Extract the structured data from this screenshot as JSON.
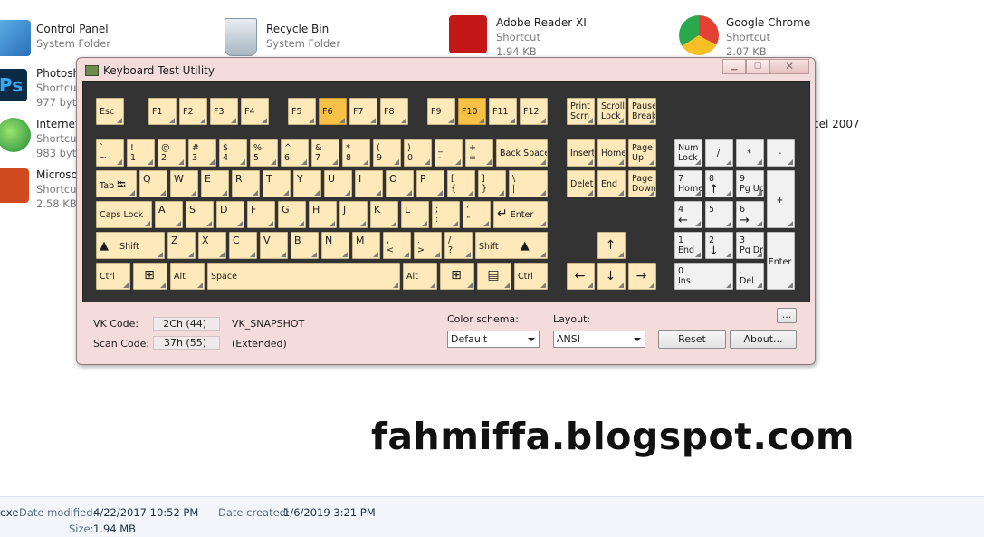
{
  "desktop": {
    "icons": [
      {
        "name": "Control Panel",
        "sub": "System Folder"
      },
      {
        "name": "Recycle Bin",
        "sub": "System Folder"
      },
      {
        "name": "Adobe Reader XI",
        "sub": "Shortcut",
        "size": "1.94 KB"
      },
      {
        "name": "Google Chrome",
        "sub": "Shortcut",
        "size": "2.07 KB"
      },
      {
        "name": "Photosh",
        "sub": "Shortcu",
        "size": "977 byte"
      },
      {
        "name": "Internet",
        "sub": "Shortcu",
        "size": "983 byte"
      },
      {
        "name": "Microso",
        "sub": "Shortcu",
        "size": "2.58 KB"
      },
      {
        "name": "cel 2007"
      }
    ],
    "watermark": "fahmiffa.blogspot.com"
  },
  "statusbar": {
    "prefix": "exe",
    "date_modified_label": "Date modified:",
    "date_modified": "4/22/2017 10:52 PM",
    "date_created_label": "Date created:",
    "date_created": "1/6/2019 3:21 PM",
    "size_label": "Size:",
    "size": "1.94 MB"
  },
  "window": {
    "title": "Keyboard Test Utility",
    "minimize": "▁",
    "maximize": "▢",
    "close": "✕"
  },
  "keys": {
    "esc": "Esc",
    "f1": "F1",
    "f2": "F2",
    "f3": "F3",
    "f4": "F4",
    "f5": "F5",
    "f6": "F6",
    "f7": "F7",
    "f8": "F8",
    "f9": "F9",
    "f10": "F10",
    "f11": "F11",
    "f12": "F12",
    "prtsc1": "Print",
    "prtsc2": "Scrn",
    "scroll1": "Scroll",
    "scroll2": "Lock",
    "pause1": "Pause",
    "pause2": "Break",
    "backtick1": "`",
    "backtick2": "~",
    "n1a": "!",
    "n1b": "1",
    "n2a": "@",
    "n2b": "2",
    "n3a": "#",
    "n3b": "3",
    "n4a": "$",
    "n4b": "4",
    "n5a": "%",
    "n5b": "5",
    "n6a": "^",
    "n6b": "6",
    "n7a": "&",
    "n7b": "7",
    "n8a": "*",
    "n8b": "8",
    "n9a": "(",
    "n9b": "9",
    "n0a": ")",
    "n0b": "0",
    "minusa": "_",
    "minusb": "-",
    "equala": "+",
    "equalb": "=",
    "backspace": "Back Space",
    "insert": "Insert",
    "home": "Home",
    "pgup1": "Page",
    "pgup2": "Up",
    "numlock1": "Num",
    "numlock2": "Lock",
    "numdiv": "/",
    "nummul": "*",
    "numsub": "-",
    "tab": "Tab",
    "tabglyph": "⭾",
    "q": "Q",
    "w": "W",
    "e": "E",
    "r": "R",
    "t": "T",
    "y": "Y",
    "u": "U",
    "i": "I",
    "o": "O",
    "p": "P",
    "lbra": "[",
    "lbrb": "{",
    "rbra": "]",
    "rbrb": "}",
    "bsla": "\\",
    "bslb": "|",
    "delete": "Delete",
    "end": "End",
    "pgdn1": "Page",
    "pgdn2": "Down",
    "num7a": "7",
    "num7b": "Home",
    "num8a": "8",
    "num8b": "↑",
    "num9a": "9",
    "num9b": "Pg Up",
    "numadd": "+",
    "caps": "Caps Lock",
    "a": "A",
    "s": "S",
    "d": "D",
    "f": "F",
    "g": "G",
    "h": "H",
    "j": "J",
    "k": "K",
    "l": "L",
    "semia": ";",
    "semib": ":",
    "quota": "'",
    "quotb": "\"",
    "enterglyph": "↵",
    "enter": "Enter",
    "num4a": "4",
    "num4b": "←",
    "num5a": "5",
    "num6a": "6",
    "num6b": "→",
    "shiftglyph": "▲",
    "shift": "Shift",
    "z": "Z",
    "x": "X",
    "c": "C",
    "v": "V",
    "b": "B",
    "n": "N",
    "m": "M",
    "comma1": ",",
    "comma2": "<",
    "period1": ".",
    "period2": ">",
    "slash1": "/",
    "slash2": "?",
    "up": "↑",
    "num1a": "1",
    "num1b": "End",
    "num2a": "2",
    "num2b": "↓",
    "num3a": "3",
    "num3b": "Pg Dn",
    "numenter": "Enter",
    "ctrl": "Ctrl",
    "winglyph": "⊞",
    "alt": "Alt",
    "space": "Space",
    "menuglyph": "▤",
    "left": "←",
    "down": "↓",
    "right": "→",
    "num0a": "0",
    "num0b": "Ins",
    "numdota": ".",
    "numdotb": "Del"
  },
  "panel": {
    "vk_label": "VK Code:",
    "vk_value": "2Ch (44)",
    "vk_name": "VK_SNAPSHOT",
    "scan_label": "Scan Code:",
    "scan_value": "37h (55)",
    "scan_ext": "(Extended)",
    "color_label": "Color schema:",
    "color_value": "Default",
    "layout_label": "Layout:",
    "layout_value": "ANSI",
    "reset": "Reset",
    "about": "About...",
    "more": "..."
  },
  "colors": {
    "key_normal": "#fde9ba",
    "key_pressed": "#f6c146",
    "key_gray": "#f1f1f1",
    "keyboard_bg": "#333333",
    "window_bg": "#f4dcdc"
  }
}
